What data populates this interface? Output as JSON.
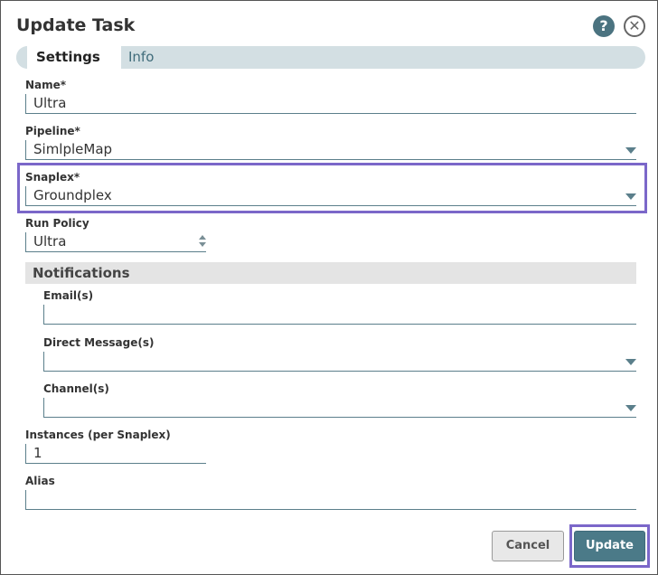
{
  "dialog": {
    "title": "Update Task",
    "help_icon": "?",
    "close_icon": "✕"
  },
  "tabs": [
    {
      "label": "Settings",
      "active": true
    },
    {
      "label": "Info",
      "active": false
    }
  ],
  "form": {
    "name": {
      "label": "Name*",
      "value": "Ultra"
    },
    "pipeline": {
      "label": "Pipeline*",
      "value": "SimlpleMap"
    },
    "snaplex": {
      "label": "Snaplex*",
      "value": "Groundplex"
    },
    "run_policy": {
      "label": "Run Policy",
      "value": "Ultra"
    },
    "notifications": {
      "header": "Notifications",
      "emails": {
        "label": "Email(s)",
        "value": ""
      },
      "direct_message": {
        "label": "Direct Message(s)",
        "value": ""
      },
      "channel": {
        "label": "Channel(s)",
        "value": ""
      }
    },
    "instances": {
      "label": "Instances (per Snaplex)",
      "value": "1"
    },
    "alias": {
      "label": "Alias",
      "value": ""
    }
  },
  "buttons": {
    "cancel": "Cancel",
    "update": "Update"
  },
  "colors": {
    "accent": "#4b7a88",
    "highlight": "#7b67c9",
    "tab_bg": "#d3dfe3"
  }
}
